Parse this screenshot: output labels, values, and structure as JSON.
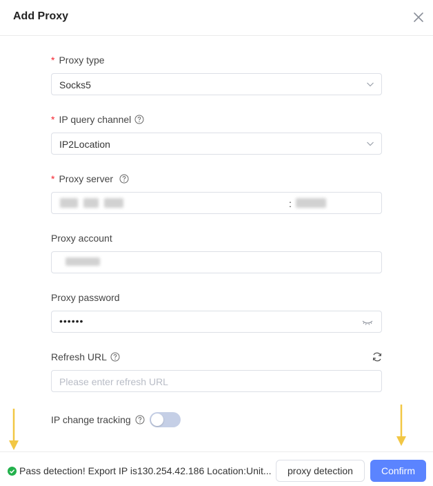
{
  "dialog": {
    "title": "Add Proxy"
  },
  "form": {
    "proxy_type": {
      "label": "Proxy type",
      "required_mark": "*",
      "value": "Socks5"
    },
    "ip_query_channel": {
      "label": "IP query channel",
      "required_mark": "*",
      "value": "IP2Location"
    },
    "proxy_server": {
      "label": "Proxy server",
      "required_mark": "*",
      "separator": ":"
    },
    "proxy_account": {
      "label": "Proxy account"
    },
    "proxy_password": {
      "label": "Proxy password",
      "value": "••••••"
    },
    "refresh_url": {
      "label": "Refresh URL",
      "placeholder": "Please enter refresh URL"
    },
    "ip_change_tracking": {
      "label": "IP change tracking",
      "enabled": false
    }
  },
  "footer": {
    "status_text": "Pass detection! Export IP is130.254.42.186 Location:Unit...",
    "detect_label": "proxy detection",
    "confirm_label": "Confirm"
  },
  "colors": {
    "accent": "#5b84ff",
    "required": "#f5222d",
    "success": "#22b14c",
    "arrow": "#f2c744"
  },
  "icons": [
    "close-icon",
    "chevron-down-icon",
    "help-icon",
    "eye-closed-icon",
    "refresh-icon",
    "check-circle-icon",
    "arrow-down-icon"
  ]
}
